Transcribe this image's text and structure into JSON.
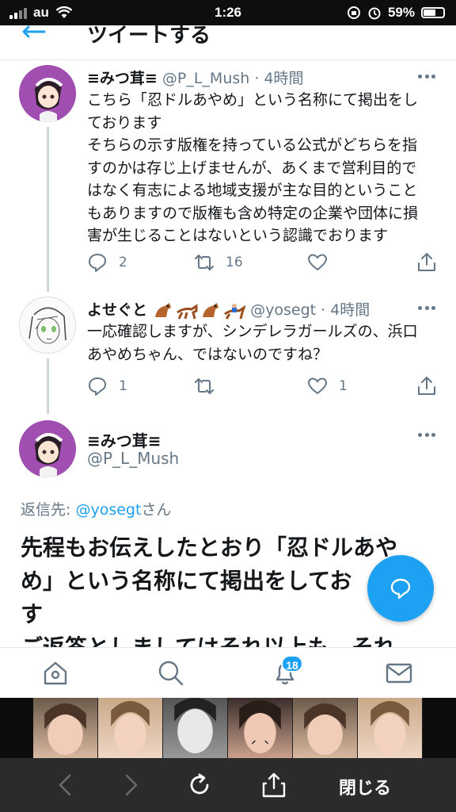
{
  "status_bar": {
    "carrier": "au",
    "time": "1:26",
    "battery": "59%",
    "battery_level": 0.59
  },
  "header": {
    "title": "ツイートする"
  },
  "tweets": [
    {
      "name": "≡みつ茸≡",
      "handle": "@P_L_Mush",
      "time": "· 4時間",
      "lines": [
        "こちら「忍ドルあやめ」という名称にて掲出をし",
        "ております",
        "そちらの示す版権を持っている公式がどちらを指",
        "すのかは存じ上げませんが、あくまで営利目的で",
        "はなく有志による地域支援が主な目的ということ",
        "もありますので版権も含め特定の企業や団体に損",
        "害が生じることはないという認識でおります"
      ],
      "replies": "2",
      "retweets": "16",
      "likes": ""
    },
    {
      "name": "よせぐと",
      "handle": "@yosegt",
      "time": "· 4時間",
      "lines": [
        "一応確認しますが、シンデレラガールズの、浜口",
        "あやめちゃん、ではないのですね？"
      ],
      "replies": "1",
      "retweets": "",
      "likes": "1"
    }
  ],
  "focused_tweet": {
    "name": "≡みつ茸≡",
    "handle": "@P_L_Mush",
    "reply_prefix": "返信先: ",
    "reply_handle": "@yosegt",
    "reply_suffix": "さん",
    "lines": [
      "先程もお伝えしたとおり「忍ドルあや",
      "め」という名称にて掲出をしてお",
      "す",
      "ご返答としましてはそれ以上も、それ"
    ]
  },
  "tab_bar": {
    "notifications_badge": "18",
    "icons": [
      "home-icon",
      "search-icon",
      "bell-icon",
      "mail-icon"
    ]
  },
  "browser_bar": {
    "close_label": "閉じる"
  },
  "colors": {
    "accent": "#1da1f2",
    "text": "#14171a",
    "muted": "#657786",
    "avatar_bg": "#a04fb0"
  }
}
